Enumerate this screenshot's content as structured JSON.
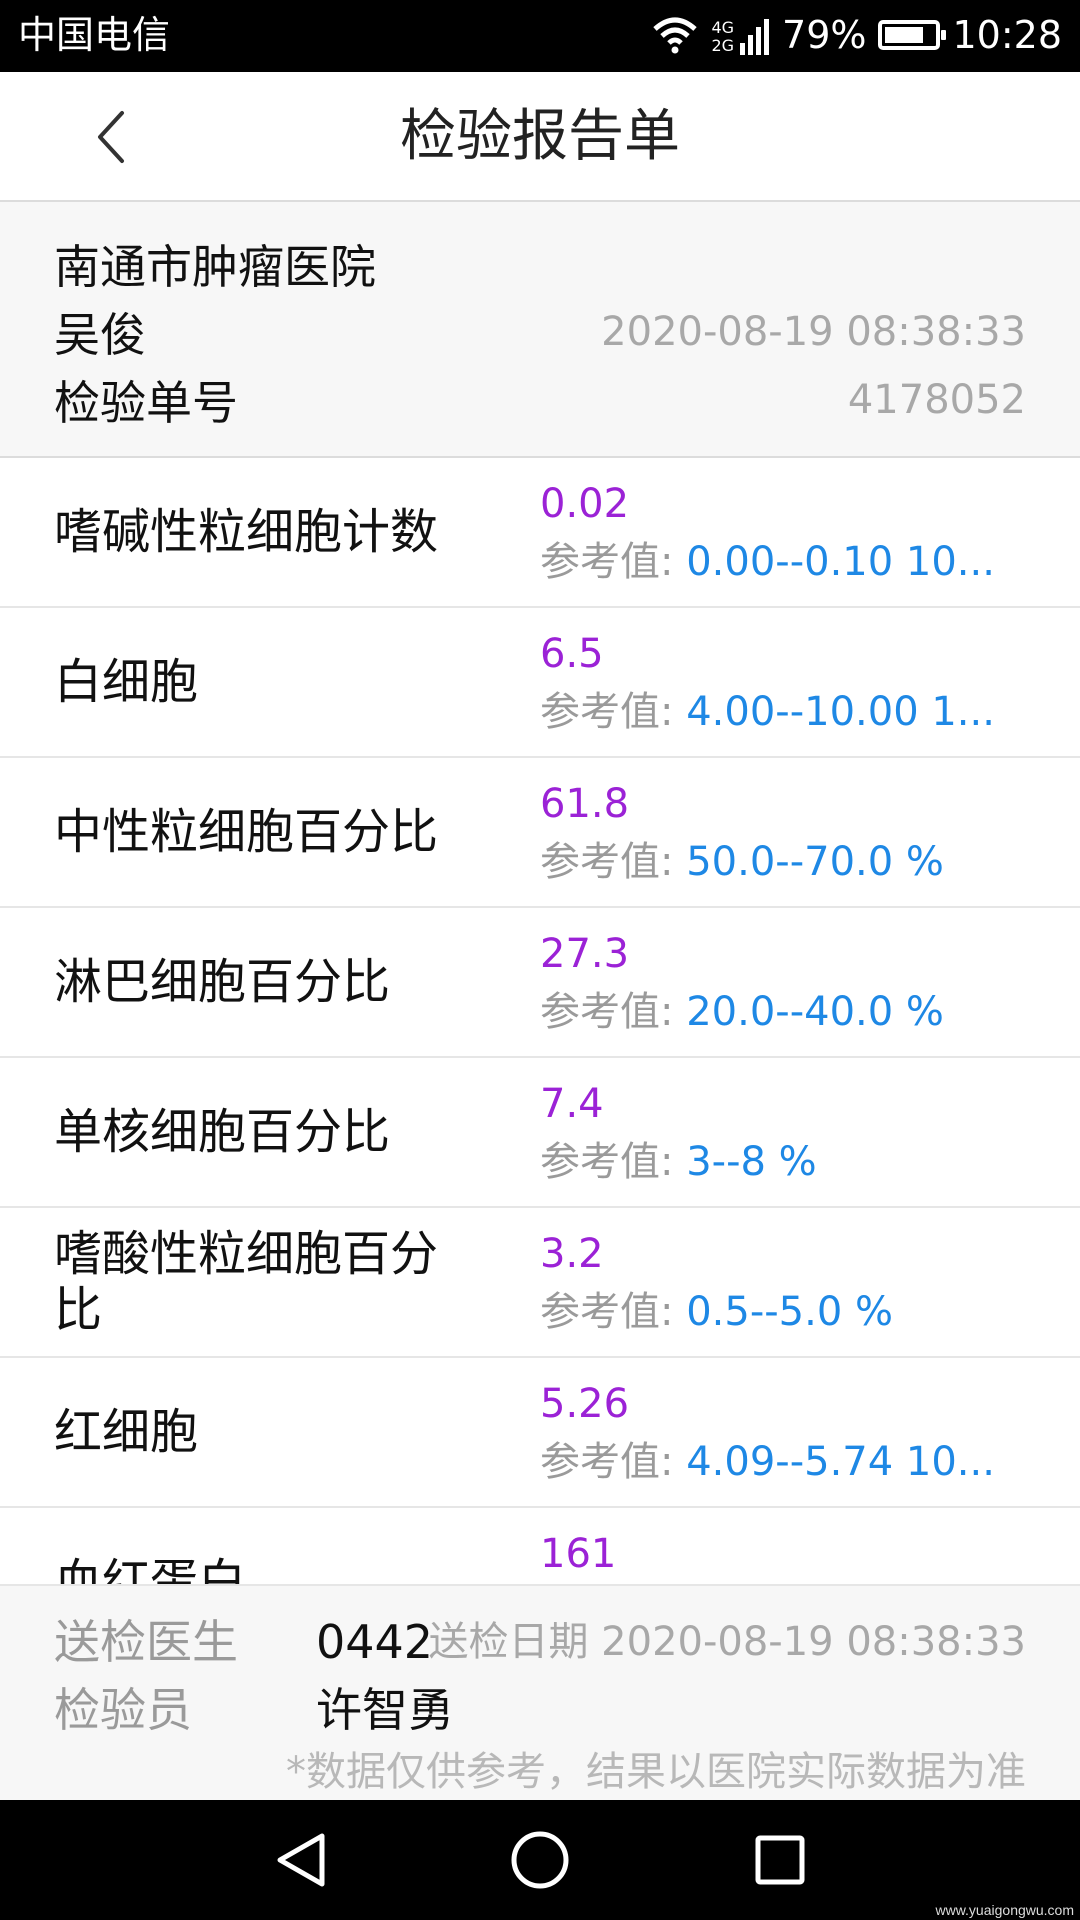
{
  "status_bar": {
    "carrier": "中国电信",
    "network_top": "4G",
    "network_bottom": "2G",
    "battery_percent": "79%",
    "battery_level": 0.79,
    "time": "10:28"
  },
  "header": {
    "title": "检验报告单",
    "back_icon": "chevron-left-icon"
  },
  "info": {
    "hospital": "南通市肿瘤医院",
    "patient_name": "吴俊",
    "datetime": "2020-08-19 08:38:33",
    "report_no_label": "检验单号",
    "report_no": "4178052"
  },
  "ref_label": "参考值:",
  "items": [
    {
      "name": "嗜碱性粒细胞计数",
      "result": "0.02",
      "reference": "0.00--0.10 10..."
    },
    {
      "name": "白细胞",
      "result": "6.5",
      "reference": "4.00--10.00 1..."
    },
    {
      "name": "中性粒细胞百分比",
      "result": "61.8",
      "reference": "50.0--70.0 %"
    },
    {
      "name": "淋巴细胞百分比",
      "result": "27.3",
      "reference": "20.0--40.0 %"
    },
    {
      "name": "单核细胞百分比",
      "result": "7.4",
      "reference": "3--8 %"
    },
    {
      "name": "嗜酸性粒细胞百分比",
      "result": "3.2",
      "reference": "0.5--5.0 %"
    },
    {
      "name": "红细胞",
      "result": "5.26",
      "reference": "4.09--5.74 10..."
    },
    {
      "name": "血红蛋白",
      "result": "161",
      "reference": ""
    }
  ],
  "footer": {
    "doctor_label": "送检医生",
    "doctor_value": "0442",
    "date_label": "送检日期",
    "date_value": "2020-08-19 08:38:33",
    "examiner_label": "检验员",
    "examiner_value": "许智勇",
    "disclaimer": "*数据仅供参考，结果以医院实际数据为准"
  },
  "nav": {
    "back_icon": "triangle-back-icon",
    "home_icon": "circle-home-icon",
    "recents_icon": "square-recents-icon"
  },
  "watermark": "www.yuaigongwu.com",
  "colors": {
    "result": "#9b22d6",
    "reference_value": "#1e88e5",
    "muted": "#9a9a9a"
  }
}
